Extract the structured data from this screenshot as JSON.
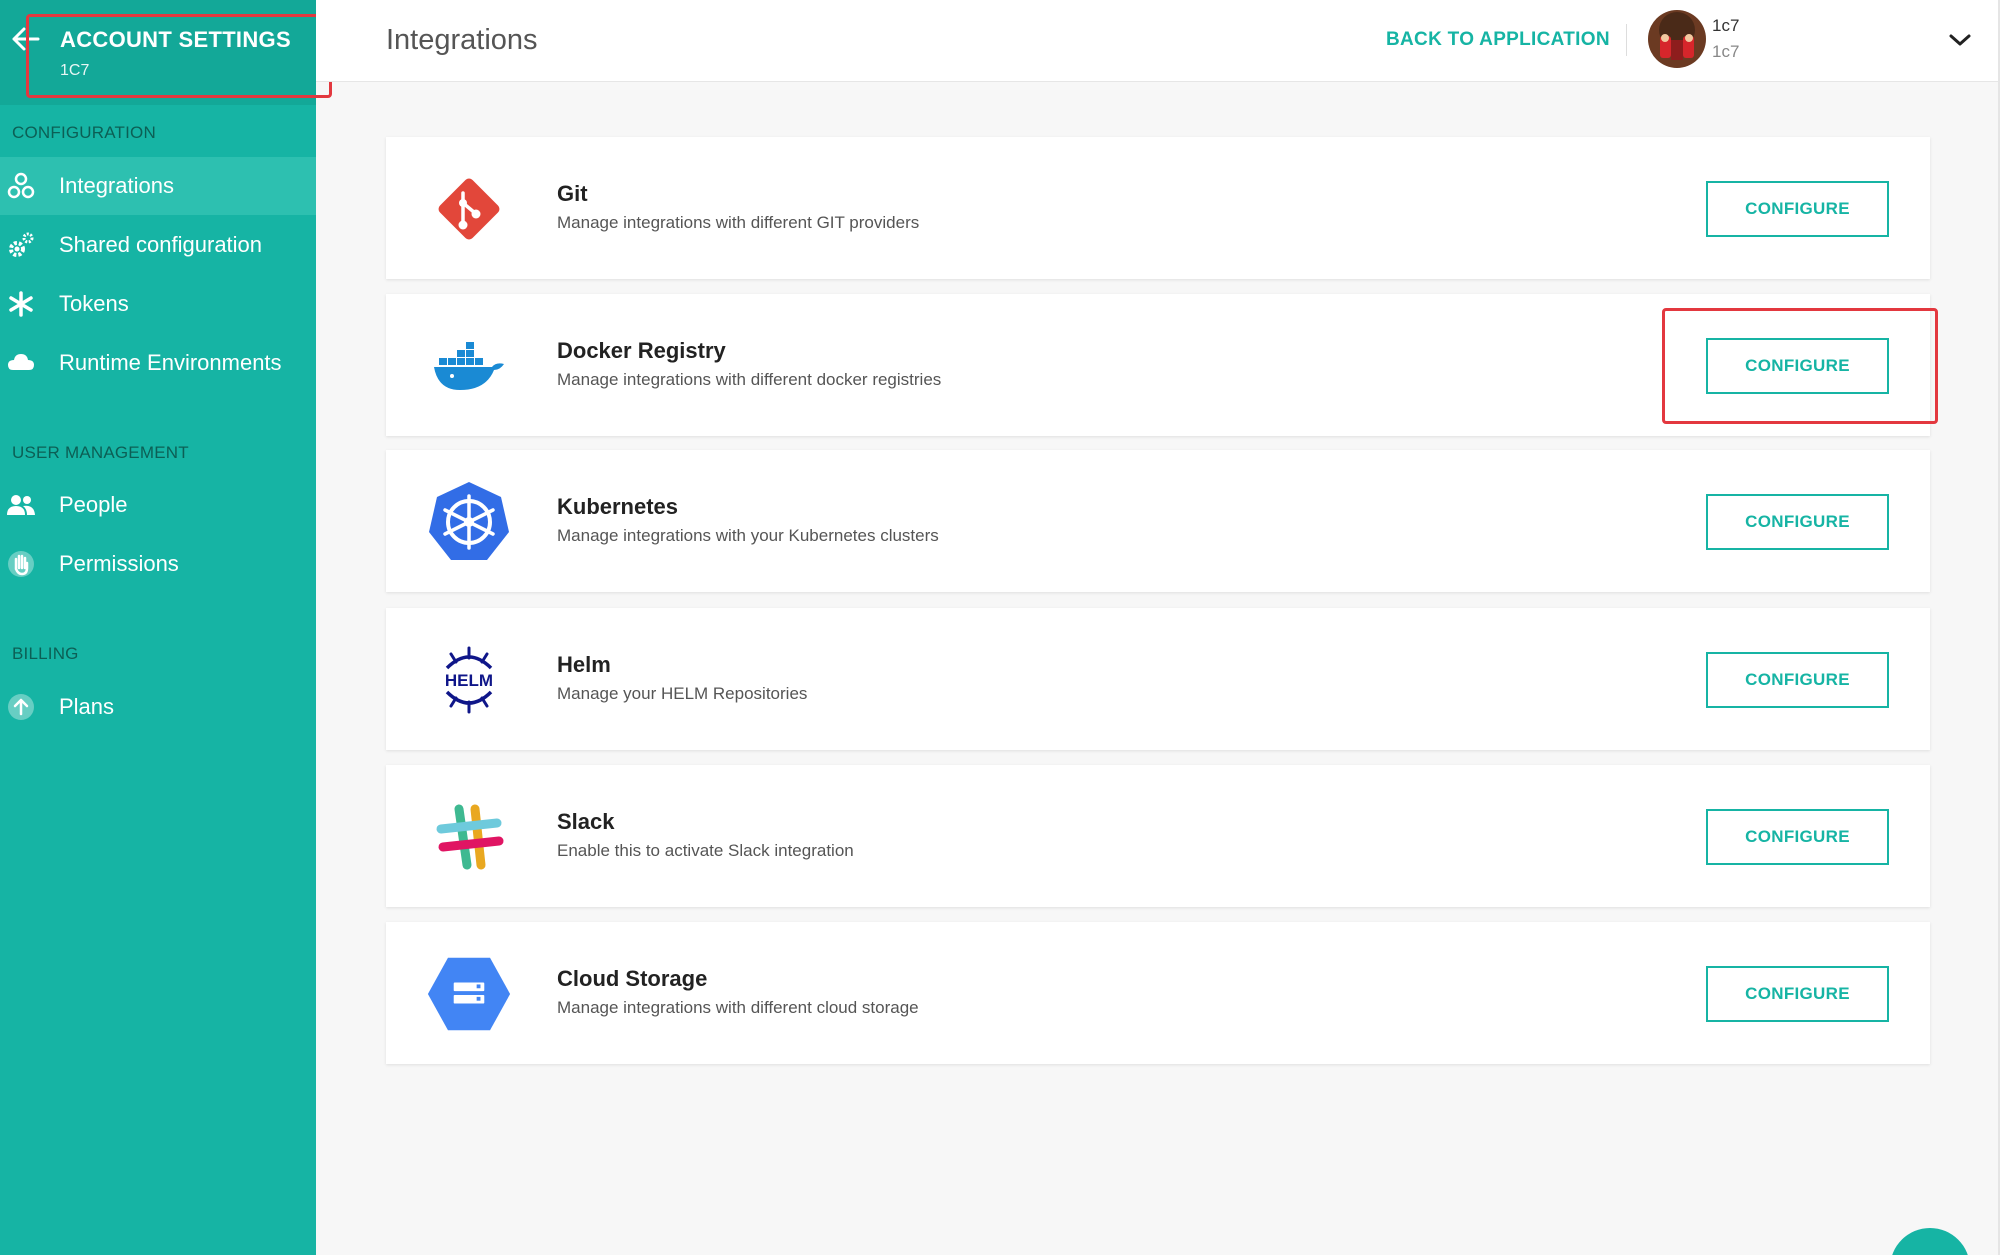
{
  "sidebar": {
    "account_title": "ACCOUNT SETTINGS",
    "account_sub": "1C7",
    "sections": {
      "configuration": "CONFIGURATION",
      "user_management": "USER MANAGEMENT",
      "billing": "BILLING"
    },
    "items": {
      "integrations": "Integrations",
      "shared_configuration": "Shared configuration",
      "tokens": "Tokens",
      "runtime_environments": "Runtime Environments",
      "people": "People",
      "permissions": "Permissions",
      "plans": "Plans"
    }
  },
  "header": {
    "title": "Integrations",
    "back_link": "BACK TO APPLICATION",
    "user_name": "1c7",
    "user_sub": "1c7"
  },
  "integrations": [
    {
      "name": "Git",
      "description": "Manage integrations with different GIT providers",
      "button": "CONFIGURE",
      "icon": "git-icon"
    },
    {
      "name": "Docker Registry",
      "description": "Manage integrations with different docker registries",
      "button": "CONFIGURE",
      "icon": "docker-icon"
    },
    {
      "name": "Kubernetes",
      "description": "Manage integrations with your Kubernetes clusters",
      "button": "CONFIGURE",
      "icon": "kubernetes-icon"
    },
    {
      "name": "Helm",
      "description": "Manage your HELM Repositories",
      "button": "CONFIGURE",
      "icon": "helm-icon",
      "logo_text": "HELM"
    },
    {
      "name": "Slack",
      "description": "Enable this to activate Slack integration",
      "button": "CONFIGURE",
      "icon": "slack-icon"
    },
    {
      "name": "Cloud Storage",
      "description": "Manage integrations with different cloud storage",
      "button": "CONFIGURE",
      "icon": "cloud-storage-icon"
    }
  ],
  "colors": {
    "accent": "#16b4a4",
    "highlight": "#e3383f"
  }
}
